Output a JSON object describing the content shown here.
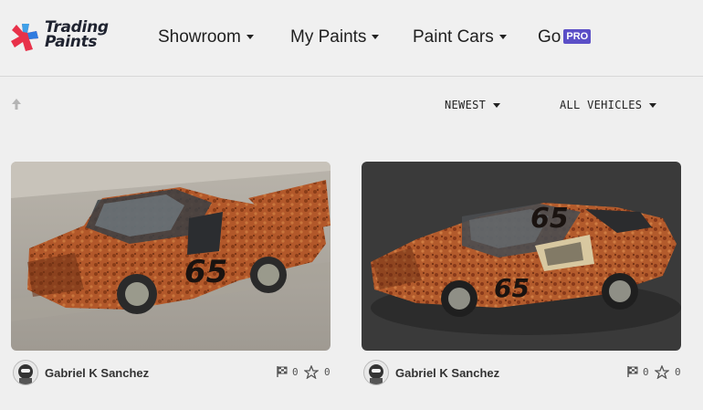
{
  "header": {
    "logo_line1": "Trading",
    "logo_line2": "Paints",
    "nav": [
      {
        "label": "Showroom"
      },
      {
        "label": "My Paints"
      },
      {
        "label": "Paint Cars"
      },
      {
        "label": "Go",
        "badge": "PRO"
      }
    ],
    "badge_color": "#5b4fc7"
  },
  "toolbar": {
    "scroll_top_icon": "arrow-up-icon",
    "sort_label": "NEWEST",
    "vehicle_filter_label": "ALL VEHICLES"
  },
  "cards": [
    {
      "image_alt": "Truck paint",
      "car_number": "65",
      "author": "Gabriel K Sanchez",
      "checkered_count": "0",
      "star_count": "0"
    },
    {
      "image_alt": "Camaro paint",
      "car_number": "65",
      "author": "Gabriel K Sanchez",
      "checkered_count": "0",
      "star_count": "0"
    }
  ]
}
